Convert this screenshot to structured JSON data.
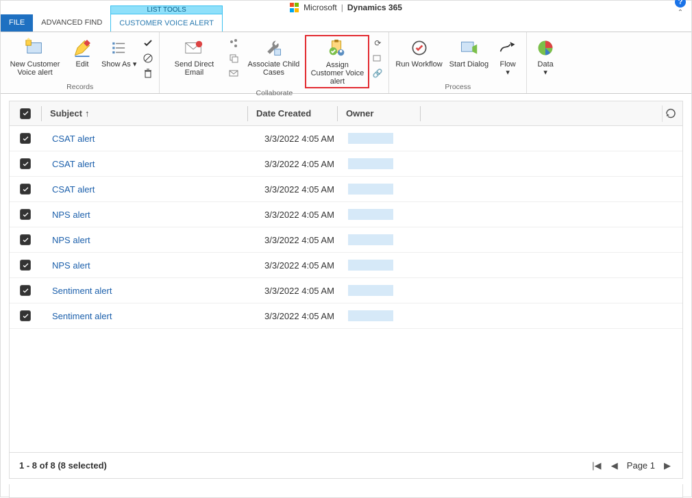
{
  "titlebar": {
    "brand_ms": "Microsoft",
    "brand_product": "Dynamics 365"
  },
  "tabs": {
    "file": "FILE",
    "advanced_find": "ADVANCED FIND",
    "context_top": "LIST TOOLS",
    "context": "CUSTOMER VOICE ALERT"
  },
  "ribbon": {
    "records": {
      "label": "Records",
      "new_alert": "New Customer Voice alert",
      "edit": "Edit",
      "show_as": "Show As"
    },
    "collaborate": {
      "label": "Collaborate",
      "send_email": "Send Direct Email",
      "associate": "Associate Child Cases",
      "assign": "Assign Customer Voice alert"
    },
    "process": {
      "label": "Process",
      "run_workflow": "Run Workflow",
      "start_dialog": "Start Dialog",
      "flow": "Flow",
      "data": "Data"
    }
  },
  "grid": {
    "col_subject": "Subject",
    "col_date": "Date Created",
    "col_owner": "Owner",
    "rows": [
      {
        "subject": "CSAT alert",
        "date": "3/3/2022 4:05 AM"
      },
      {
        "subject": "CSAT alert",
        "date": "3/3/2022 4:05 AM"
      },
      {
        "subject": "CSAT alert",
        "date": "3/3/2022 4:05 AM"
      },
      {
        "subject": "NPS alert",
        "date": "3/3/2022 4:05 AM"
      },
      {
        "subject": "NPS alert",
        "date": "3/3/2022 4:05 AM"
      },
      {
        "subject": "NPS alert",
        "date": "3/3/2022 4:05 AM"
      },
      {
        "subject": "Sentiment alert",
        "date": "3/3/2022 4:05 AM"
      },
      {
        "subject": "Sentiment alert",
        "date": "3/3/2022 4:05 AM"
      }
    ],
    "footer_status": "1 - 8 of 8 (8 selected)",
    "page_label": "Page 1"
  }
}
